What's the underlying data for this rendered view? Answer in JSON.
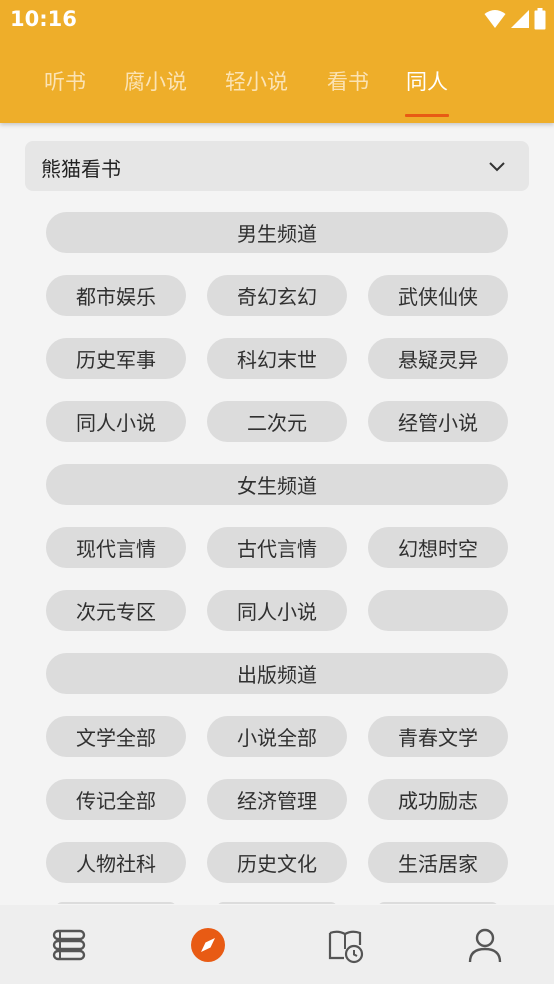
{
  "status": {
    "time": "10:16"
  },
  "tabs": [
    {
      "label": "听书",
      "active": false
    },
    {
      "label": "腐小说",
      "active": false
    },
    {
      "label": "轻小说",
      "active": false
    },
    {
      "label": "看书",
      "active": false
    },
    {
      "label": "同人",
      "active": true
    }
  ],
  "source": {
    "selected": "熊猫看书"
  },
  "sections": [
    {
      "title": "男生频道",
      "categories": [
        "都市娱乐",
        "奇幻玄幻",
        "武侠仙侠",
        "历史军事",
        "科幻末世",
        "悬疑灵异",
        "同人小说",
        "二次元",
        "经管小说"
      ]
    },
    {
      "title": "女生频道",
      "categories": [
        "现代言情",
        "古代言情",
        "幻想时空",
        "次元专区",
        "同人小说",
        ""
      ]
    },
    {
      "title": "出版频道",
      "categories": [
        "文学全部",
        "小说全部",
        "青春文学",
        "传记全部",
        "经济管理",
        "成功励志",
        "人物社科",
        "历史文化",
        "生活居家"
      ]
    }
  ],
  "bottom_nav": [
    {
      "icon": "bookshelf-icon",
      "active": false
    },
    {
      "icon": "compass-icon",
      "active": true
    },
    {
      "icon": "history-icon",
      "active": false
    },
    {
      "icon": "profile-icon",
      "active": false
    }
  ],
  "colors": {
    "primary": "#eeae2a",
    "accent": "#e85b14",
    "pill": "#dcdcdc",
    "background": "#f4f4f4"
  }
}
